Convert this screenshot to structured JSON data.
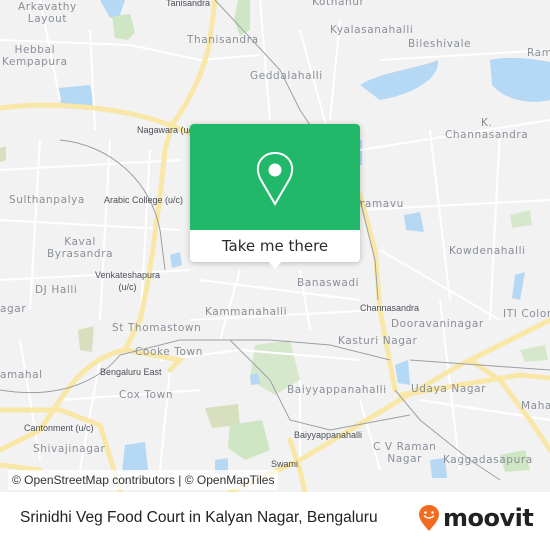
{
  "map": {
    "labels": [
      {
        "id": "arkavathy-layout",
        "text": "Arkavathy\nLayout"
      },
      {
        "id": "tanisandra",
        "text": "Tanisandra"
      },
      {
        "id": "kothanur",
        "text": "Kothanur"
      },
      {
        "id": "thanisandra",
        "text": "Thanisandra"
      },
      {
        "id": "kyalasanahalli",
        "text": "Kyalasanahalli"
      },
      {
        "id": "bileshivale",
        "text": "Bileshivale"
      },
      {
        "id": "ram",
        "text": "Ram"
      },
      {
        "id": "hebbal-kempapura",
        "text": "Hebbal\nKempapura"
      },
      {
        "id": "geddalahalli",
        "text": "Geddalahalli"
      },
      {
        "id": "nagawara",
        "text": "Nagawara (u/c)"
      },
      {
        "id": "k-channasandra",
        "text": "K.\nChannasandra"
      },
      {
        "id": "sulthanpalya",
        "text": "Sulthanpalya"
      },
      {
        "id": "arabic-college",
        "text": "Arabic College (u/c)"
      },
      {
        "id": "hennur-bande",
        "text": "ramavu"
      },
      {
        "id": "kaval-byrasandra",
        "text": "Kaval\nByrasandra"
      },
      {
        "id": "kowdenahalli",
        "text": "Kowdenahalli"
      },
      {
        "id": "venkateshapura",
        "text": "Venkateshapura\n(u/c)"
      },
      {
        "id": "banaswadi",
        "text": "Banaswadi"
      },
      {
        "id": "dj-halli",
        "text": "DJ Halli"
      },
      {
        "id": "channasandra",
        "text": "Channasandra"
      },
      {
        "id": "nagar-left",
        "text": "agar"
      },
      {
        "id": "kammanahalli",
        "text": "Kammanahalli"
      },
      {
        "id": "dooravaninagar",
        "text": "Dooravaninagar"
      },
      {
        "id": "iti-colony",
        "text": "ITI Colon"
      },
      {
        "id": "st-thomastown",
        "text": "St Thomastown"
      },
      {
        "id": "cooke-town",
        "text": "Cooke Town"
      },
      {
        "id": "kasturi-nagar",
        "text": "Kasturi Nagar"
      },
      {
        "id": "bengaluru-east",
        "text": "Bengaluru East"
      },
      {
        "id": "amahal",
        "text": "amahal"
      },
      {
        "id": "cox-town",
        "text": "Cox Town"
      },
      {
        "id": "baiyyappanahalli",
        "text": "Baiyyappanahalli"
      },
      {
        "id": "udaya-nagar",
        "text": "Udaya Nagar"
      },
      {
        "id": "maha",
        "text": "Maha"
      },
      {
        "id": "cantonment",
        "text": "Cantonment (u/c)"
      },
      {
        "id": "baiyyappanahalli-station",
        "text": "Baiyyappanahalli"
      },
      {
        "id": "shivajinagar",
        "text": "Shivajinagar"
      },
      {
        "id": "cv-raman-nagar",
        "text": "C V Raman\nNagar"
      },
      {
        "id": "kaggadasapura",
        "text": "Kaggadasapura"
      },
      {
        "id": "swami",
        "text": "Swami"
      }
    ],
    "attribution": "© OpenStreetMap contributors | © OpenMapTiles"
  },
  "popup": {
    "icon": "location-pin-icon",
    "cta_label": "Take me there",
    "color": "#21b86a"
  },
  "footer": {
    "title": "Srinidhi Veg Food Court in Kalyan Nagar, Bengaluru",
    "brand": "moovit",
    "brand_color": "#f26b21"
  }
}
